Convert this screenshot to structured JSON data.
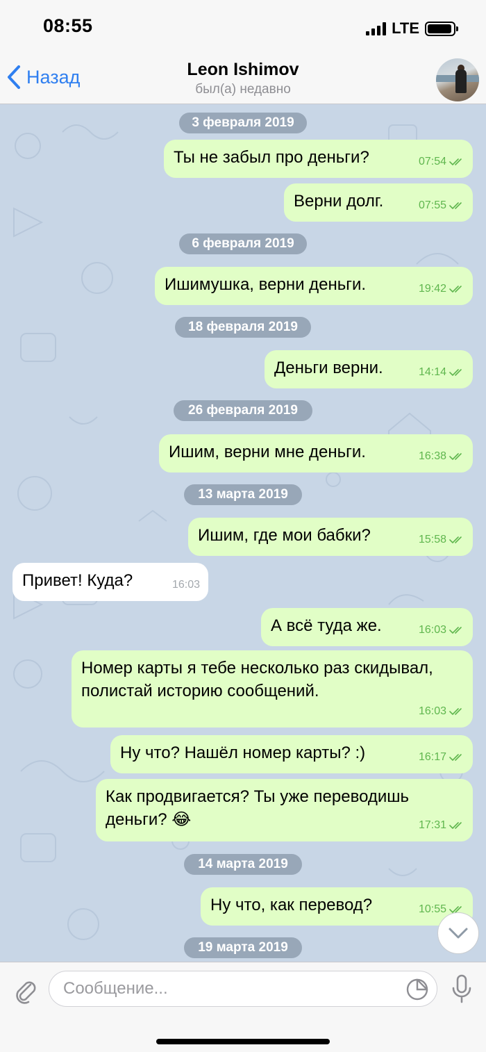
{
  "status": {
    "time": "08:55",
    "network": "LTE",
    "battery_level": 0.95
  },
  "nav": {
    "back_label": "Назад",
    "title": "Leon Ishimov",
    "subtitle": "был(а) недавно"
  },
  "messages": [
    {
      "type": "date",
      "text": "3 февраля 2019"
    },
    {
      "type": "out",
      "text": "Ты не забыл про деньги?",
      "time": "07:54",
      "read": true
    },
    {
      "type": "out",
      "text": "Верни долг.",
      "time": "07:55",
      "read": true
    },
    {
      "type": "date",
      "text": "6 февраля 2019"
    },
    {
      "type": "out",
      "text": "Ишимушка, верни деньги.",
      "time": "19:42",
      "read": true
    },
    {
      "type": "date",
      "text": "18 февраля 2019"
    },
    {
      "type": "out",
      "text": "Деньги верни.",
      "time": "14:14",
      "read": true
    },
    {
      "type": "date",
      "text": "26 февраля 2019"
    },
    {
      "type": "out",
      "text": "Ишим, верни мне деньги.",
      "time": "16:38",
      "read": true
    },
    {
      "type": "date",
      "text": "13 марта 2019"
    },
    {
      "type": "out",
      "text": "Ишим, где мои бабки?",
      "time": "15:58",
      "read": true
    },
    {
      "type": "in",
      "text": "Привет! Куда?",
      "time": "16:03"
    },
    {
      "type": "out",
      "text": "А всё туда же.",
      "time": "16:03",
      "read": true
    },
    {
      "type": "out",
      "text": "Номер карты я тебе несколько раз скидывал, полистай историю сообщений.",
      "time": "16:03",
      "read": true
    },
    {
      "type": "out",
      "text": "Ну что? Нашёл номер карты? :)",
      "time": "16:17",
      "read": true
    },
    {
      "type": "out",
      "text": "Как продвигается? Ты уже переводишь деньги? 😂",
      "time": "17:31",
      "read": true
    },
    {
      "type": "date",
      "text": "14 марта 2019"
    },
    {
      "type": "out",
      "text": "Ну что, как перевод?",
      "time": "10:55",
      "read": true
    },
    {
      "type": "date",
      "text": "19 марта 2019"
    }
  ],
  "composer": {
    "placeholder": "Сообщение..."
  },
  "icons": {
    "back": "chevron-left-icon",
    "attach": "paperclip-icon",
    "sticker": "sticker-icon",
    "mic": "microphone-icon",
    "scroll": "chevron-down-icon"
  },
  "colors": {
    "accent": "#2f7ff0",
    "bubble_out": "#e1fec6",
    "bubble_in": "#ffffff",
    "chat_bg": "#c8d6e6",
    "read_ticks": "#5fb64e"
  }
}
